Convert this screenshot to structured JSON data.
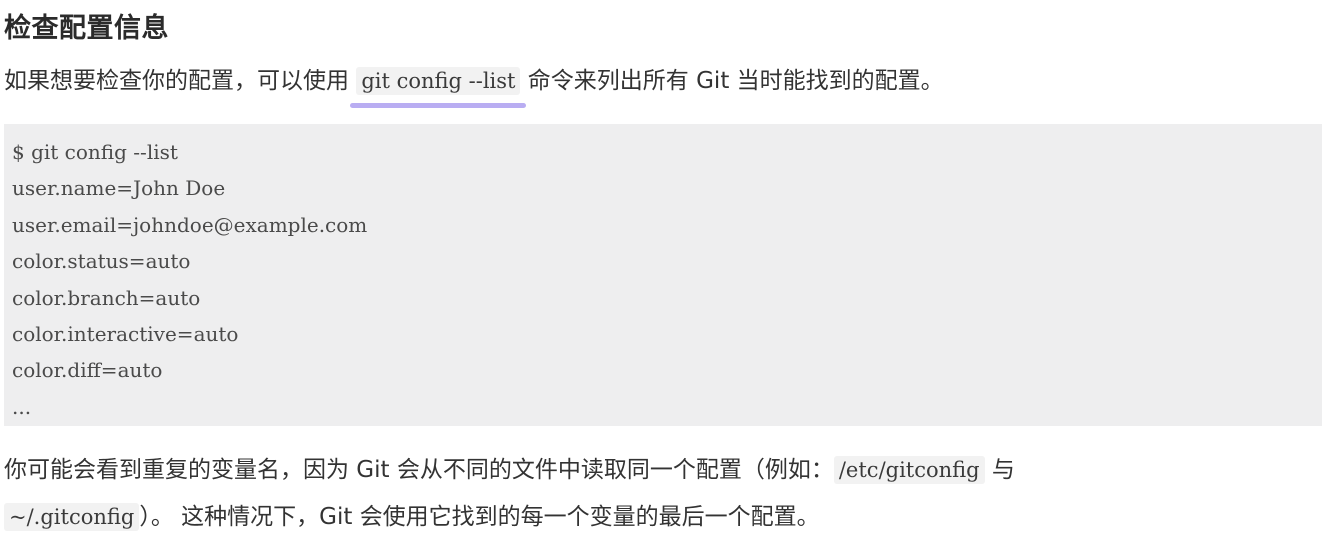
{
  "heading": "检查配置信息",
  "para1": {
    "before": "如果想要检查你的配置，可以使用 ",
    "code": "git config --list",
    "after": " 命令来列出所有 Git 当时能找到的配置。"
  },
  "code_block": {
    "lines": [
      "$ git config --list",
      "user.name=John Doe",
      "user.email=johndoe@example.com",
      "color.status=auto",
      "color.branch=auto",
      "color.interactive=auto",
      "color.diff=auto",
      "..."
    ]
  },
  "para2": {
    "before": "你可能会看到重复的变量名，因为 Git 会从不同的文件中读取同一个配置（例如：",
    "code": "/etc/gitconfig",
    "after": " 与"
  },
  "para3": {
    "code": "~/.gitconfig",
    "after": "）。 这种情况下，Git 会使用它找到的每一个变量的最后一个配置。"
  },
  "colors": {
    "underline": "#b9adf2",
    "code_background": "#eeeeef"
  }
}
